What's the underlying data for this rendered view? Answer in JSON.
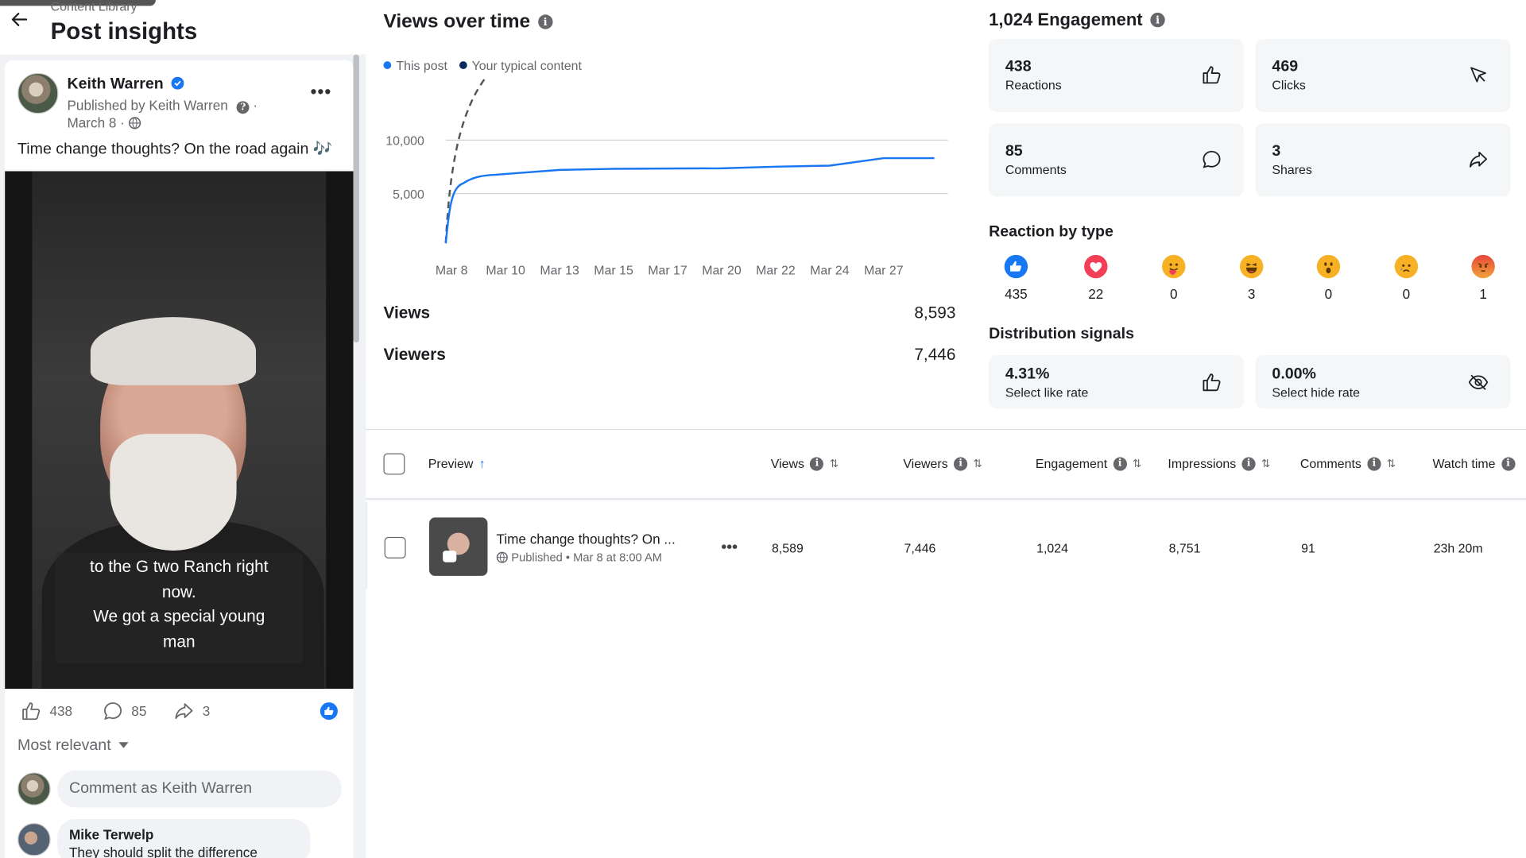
{
  "header": {
    "breadcrumb": "Content Library",
    "title": "Post insights"
  },
  "post": {
    "author": "Keith Warren",
    "published_by": "Published by Keith Warren",
    "date": "March 8 ·",
    "caption": "Time change thoughts? On the road again 🎶",
    "subtitle_lines": [
      "to the G two Ranch right",
      "now.",
      "We got a special young",
      "man"
    ],
    "reactions_count": "438",
    "comments_count": "85",
    "shares_count": "3",
    "sort_label": "Most relevant",
    "comment_placeholder": "Comment as Keith Warren",
    "comment": {
      "name": "Mike Terwelp",
      "text": "They should split the difference"
    }
  },
  "views_over_time": {
    "title": "Views over time",
    "legend": [
      "This post",
      "Your typical content"
    ],
    "colors": {
      "this_post": "#1877f2",
      "typical": "#0a2a5e"
    },
    "views_label": "Views",
    "views_value": "8,593",
    "viewers_label": "Viewers",
    "viewers_value": "7,446"
  },
  "chart_data": {
    "type": "line",
    "x": [
      "Mar 8",
      "Mar 10",
      "Mar 13",
      "Mar 15",
      "Mar 17",
      "Mar 20",
      "Mar 22",
      "Mar 24",
      "Mar 27"
    ],
    "y_ticks": [
      "10,000",
      "5,000"
    ],
    "series": [
      {
        "name": "This post",
        "style": "solid",
        "values": [
          0,
          6400,
          6850,
          6950,
          6980,
          7000,
          7150,
          7250,
          7950
        ]
      },
      {
        "name": "Your typical content",
        "style": "dashed",
        "values_partial": [
          0,
          16000
        ]
      }
    ],
    "ylim": [
      0,
      16000
    ],
    "grid": true
  },
  "engagement": {
    "title": "1,024 Engagement",
    "tiles": [
      {
        "value": "438",
        "label": "Reactions",
        "icon": "thumbs-up-icon"
      },
      {
        "value": "469",
        "label": "Clicks",
        "icon": "cursor-icon"
      },
      {
        "value": "85",
        "label": "Comments",
        "icon": "comment-icon"
      },
      {
        "value": "3",
        "label": "Shares",
        "icon": "share-icon"
      }
    ]
  },
  "reaction_by_type": {
    "title": "Reaction by type",
    "items": [
      {
        "type": "like",
        "count": "435",
        "color": "#1877f2"
      },
      {
        "type": "love",
        "count": "22",
        "color": "#f33e58"
      },
      {
        "type": "care",
        "count": "0",
        "color": "#f7b125"
      },
      {
        "type": "haha",
        "count": "3",
        "color": "#f7b125"
      },
      {
        "type": "wow",
        "count": "0",
        "color": "#f7b125"
      },
      {
        "type": "sad",
        "count": "0",
        "color": "#f7b125"
      },
      {
        "type": "angry",
        "count": "1",
        "color": "#e9710f"
      }
    ]
  },
  "distribution": {
    "title": "Distribution signals",
    "tiles": [
      {
        "value": "4.31%",
        "label": "Select like rate",
        "icon": "thumbs-up-icon"
      },
      {
        "value": "0.00%",
        "label": "Select hide rate",
        "icon": "eye-off-icon"
      }
    ]
  },
  "table": {
    "columns": [
      "Preview",
      "Views",
      "Viewers",
      "Engagement",
      "Impressions",
      "Comments",
      "Watch time"
    ],
    "rows": [
      {
        "title": "Time change thoughts? On ...",
        "subtitle": "Published • Mar 8 at 8:00 AM",
        "views": "8,589",
        "viewers": "7,446",
        "engagement": "1,024",
        "impressions": "8,751",
        "comments": "91",
        "watch_time": "23h 20m"
      }
    ]
  }
}
